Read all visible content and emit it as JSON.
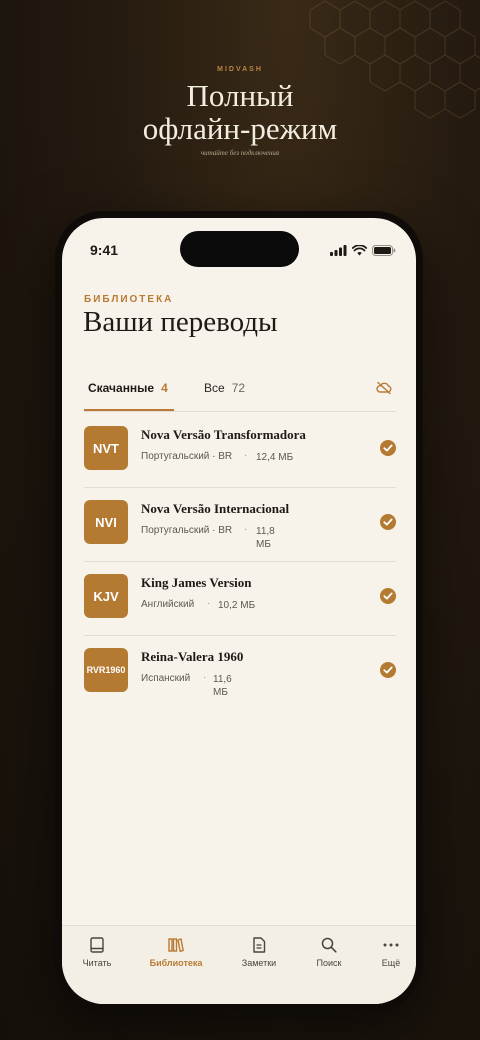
{
  "promo": {
    "brand": "MIDVASH",
    "headline_line1": "Полный",
    "headline_line2": "офлайн-режим",
    "tagline": "читайте без подключения"
  },
  "status_bar": {
    "time": "9:41"
  },
  "library": {
    "section_label": "БИБЛИОТЕКА",
    "title": "Ваши переводы",
    "tabs": [
      {
        "label": "Скачанные",
        "count": "4"
      },
      {
        "label": "Все",
        "count": "72"
      }
    ],
    "translations": [
      {
        "abbr": "NVT",
        "name": "Nova Versão Transformadora",
        "language": "Португальский · BR",
        "size": "12,4 МБ"
      },
      {
        "abbr": "NVI",
        "name": "Nova Versão Internacional",
        "language": "Португальский · BR",
        "size": "11,8 МБ"
      },
      {
        "abbr": "KJV",
        "name": "King James Version",
        "language": "Английский",
        "size": "10,2 МБ"
      },
      {
        "abbr": "RVR1960",
        "name": "Reina-Valera 1960",
        "language": "Испанский",
        "size": "11,6 МБ"
      }
    ]
  },
  "tab_bar": {
    "items": [
      {
        "label": "Читать",
        "icon": "book-icon"
      },
      {
        "label": "Библиотека",
        "icon": "library-icon"
      },
      {
        "label": "Заметки",
        "icon": "notes-icon"
      },
      {
        "label": "Поиск",
        "icon": "search-icon"
      },
      {
        "label": "Ещё",
        "icon": "more-icon"
      }
    ]
  },
  "colors": {
    "accent": "#b87a34",
    "background": "#f7f3ea",
    "page_dark": "#1d150d"
  }
}
